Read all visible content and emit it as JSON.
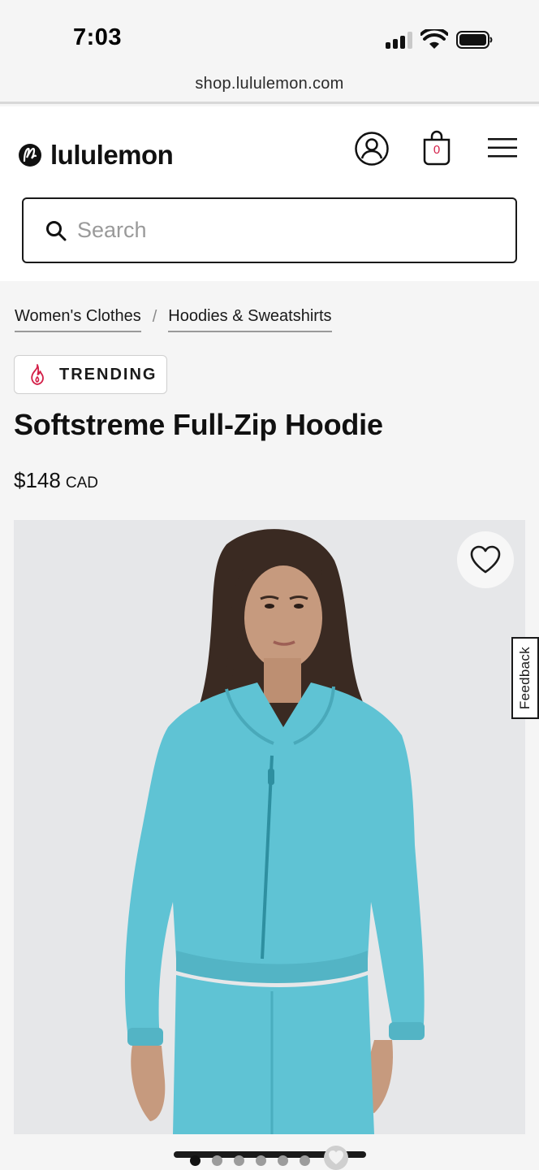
{
  "status_bar": {
    "time": "7:03",
    "icons": [
      "signal-icon",
      "wifi-icon",
      "battery-icon"
    ]
  },
  "browser": {
    "url": "shop.lululemon.com"
  },
  "header": {
    "brand": "lululemon",
    "icons": [
      "lululemon-logo-icon",
      "account-icon",
      "shopping-bag-icon",
      "menu-icon"
    ],
    "bag_count": "0"
  },
  "search": {
    "placeholder": "Search",
    "value": ""
  },
  "breadcrumb": {
    "items": [
      "Women's Clothes",
      "Hoodies & Sweatshirts"
    ],
    "separator": "/"
  },
  "badge": {
    "label": "TRENDING",
    "icon": "flame-icon"
  },
  "product": {
    "title": "Softstreme Full-Zip Hoodie",
    "price": "$148",
    "currency": "CAD",
    "color_hex": "#5fc3d4"
  },
  "feedback_tab": {
    "label": "Feedback"
  },
  "carousel": {
    "total_dots": 6,
    "active_index": 0
  },
  "colors": {
    "accent": "#d31e47",
    "text": "#1a1a1a",
    "background": "#f5f5f5"
  }
}
